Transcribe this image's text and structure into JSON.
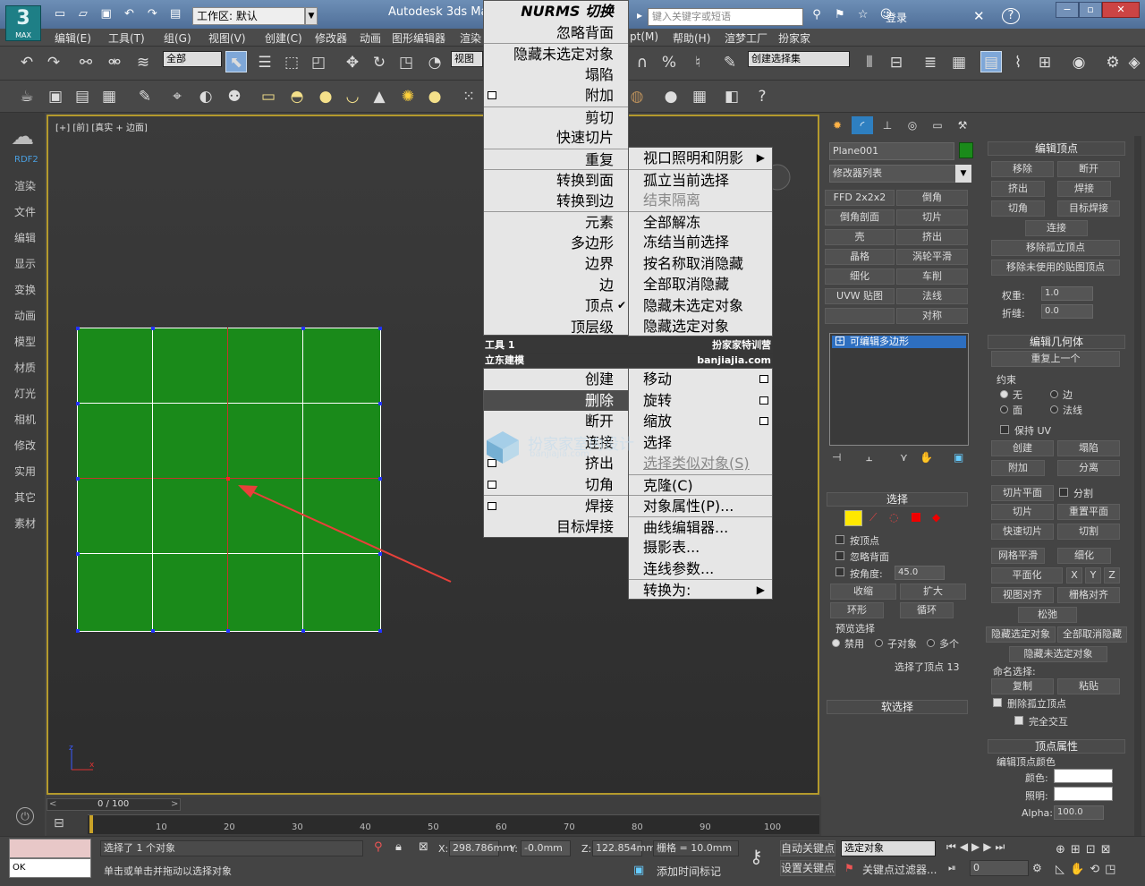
{
  "app": {
    "title": "Autodesk 3ds Max",
    "workspace_label": "工作区: 默认",
    "search_placeholder": "键入关键字或短语",
    "login": "登录",
    "logo_text": "MAX"
  },
  "menubar": [
    "编辑(E)",
    "工具(T)",
    "组(G)",
    "视图(V)",
    "创建(C)",
    "修改器",
    "动画",
    "图形编辑器",
    "渲染",
    "pt(M)",
    "帮助(H)",
    "渲梦工厂",
    "扮家家"
  ],
  "toolbar": {
    "selection_filter": "全部",
    "ref_coord": "视图",
    "named_sel_set": "创建选择集"
  },
  "left_sidebar": [
    "RDF2",
    "渲染",
    "文件",
    "编辑",
    "显示",
    "变换",
    "动画",
    "模型",
    "材质",
    "灯光",
    "相机",
    "修改",
    "实用",
    "其它",
    "素材"
  ],
  "viewport": {
    "label": "[+] [前] [真实 + 边面]"
  },
  "quad_menu": {
    "left": [
      "NURMS 切换",
      "忽略背面",
      "隐藏未选定对象",
      "塌陷",
      "附加",
      "剪切",
      "快速切片",
      "重复",
      "转换到面",
      "转换到边",
      "元素",
      "多边形",
      "边界",
      "边",
      "顶点",
      "顶层级"
    ],
    "header_left_top": "工具 1",
    "header_left_bottom": "立东建模",
    "header_right_top": "扮家家特训营",
    "header_right_bottom": "banjiajia.com",
    "bottom_left": [
      "创建",
      "删除",
      "断开",
      "连接",
      "挤出",
      "切角",
      "焊接",
      "目标焊接"
    ],
    "right_top": [
      "视口照明和阴影",
      "孤立当前选择",
      "结束隔离",
      "全部解冻",
      "冻结当前选择",
      "按名称取消隐藏",
      "全部取消隐藏",
      "隐藏未选定对象",
      "隐藏选定对象"
    ],
    "right_bottom": [
      "移动",
      "旋转",
      "缩放",
      "选择",
      "选择类似对象(S)",
      "克隆(C)",
      "对象属性(P)...",
      "曲线编辑器...",
      "摄影表...",
      "连线参数...",
      "转换为:"
    ]
  },
  "watermark": {
    "text": "扮家家室内设计",
    "sub": "banjiajia.com"
  },
  "modify_panel": {
    "object_name": "Plane001",
    "modifier_list": "修改器列表",
    "modifier_buttons": [
      "FFD 2x2x2",
      "倒角",
      "倒角剖面",
      "切片",
      "壳",
      "挤出",
      "晶格",
      "涡轮平滑",
      "细化",
      "车削",
      "UVW 贴图",
      "法线",
      "",
      "对称"
    ],
    "stack_item": "可编辑多边形",
    "selection_title": "选择",
    "by_vertex": "按顶点",
    "ignore_backfacing": "忽略背面",
    "by_angle": "按角度:",
    "angle_value": "45.0",
    "shrink": "收缩",
    "grow": "扩大",
    "ring": "环形",
    "loop": "循环",
    "preview_sel": "预览选择",
    "preview_opts": [
      "禁用",
      "子对象",
      "多个"
    ],
    "selected_text": "选择了顶点 13",
    "soft_sel": "软选择"
  },
  "edit_vertices": {
    "title": "编辑顶点",
    "buttons": [
      "移除",
      "断开",
      "挤出",
      "焊接",
      "切角",
      "目标焊接",
      "连接",
      "移除孤立顶点",
      "移除未使用的贴图顶点"
    ],
    "weight_label": "权重:",
    "weight": "1.0",
    "crease_label": "折缝:",
    "crease": "0.0"
  },
  "edit_geometry": {
    "title": "编辑几何体",
    "repeat": "重复上一个",
    "constraints": "约束",
    "constraint_opts": [
      "无",
      "边",
      "面",
      "法线"
    ],
    "preserve_uv": "保持 UV",
    "buttons": [
      "创建",
      "塌陷",
      "附加",
      "分离",
      "切片平面",
      "分割",
      "切片",
      "重置平面",
      "快速切片",
      "切割",
      "网格平滑",
      "细化",
      "平面化",
      "X",
      "Y",
      "Z",
      "视图对齐",
      "栅格对齐",
      "松弛",
      "隐藏选定对象",
      "全部取消隐藏",
      "隐藏未选定对象"
    ],
    "named_sel": "命名选择:",
    "copy": "复制",
    "paste": "粘贴",
    "delete_isolated": "删除孤立顶点",
    "full_interop": "完全交互"
  },
  "vertex_props": {
    "title": "顶点属性",
    "edit_color": "编辑顶点颜色",
    "color_label": "颜色:",
    "illum_label": "照明:",
    "alpha_label": "Alpha:",
    "alpha": "100.0"
  },
  "timeline": {
    "frame": "0 / 100",
    "ticks": [
      "10",
      "20",
      "30",
      "40",
      "50",
      "60",
      "70",
      "80",
      "90",
      "100"
    ]
  },
  "status": {
    "selected": "选择了 1 个对象",
    "prompt": "单击或单击并拖动以选择对象",
    "x_label": "X:",
    "x": "298.786mm",
    "y_label": "Y:",
    "y": "-0.0mm",
    "z_label": "Z:",
    "z": "122.854mm",
    "grid": "栅格 = 10.0mm",
    "auto_key": "自动关键点",
    "set_key": "设置关键点",
    "sel_obj": "选定对象",
    "key_filters": "关键点过滤器...",
    "add_time_tag": "添加时间标记",
    "frame_field": "0",
    "mini_listener": "OK"
  },
  "colors": {
    "plane": "#1a8a1a",
    "accent": "#b49a2c"
  }
}
